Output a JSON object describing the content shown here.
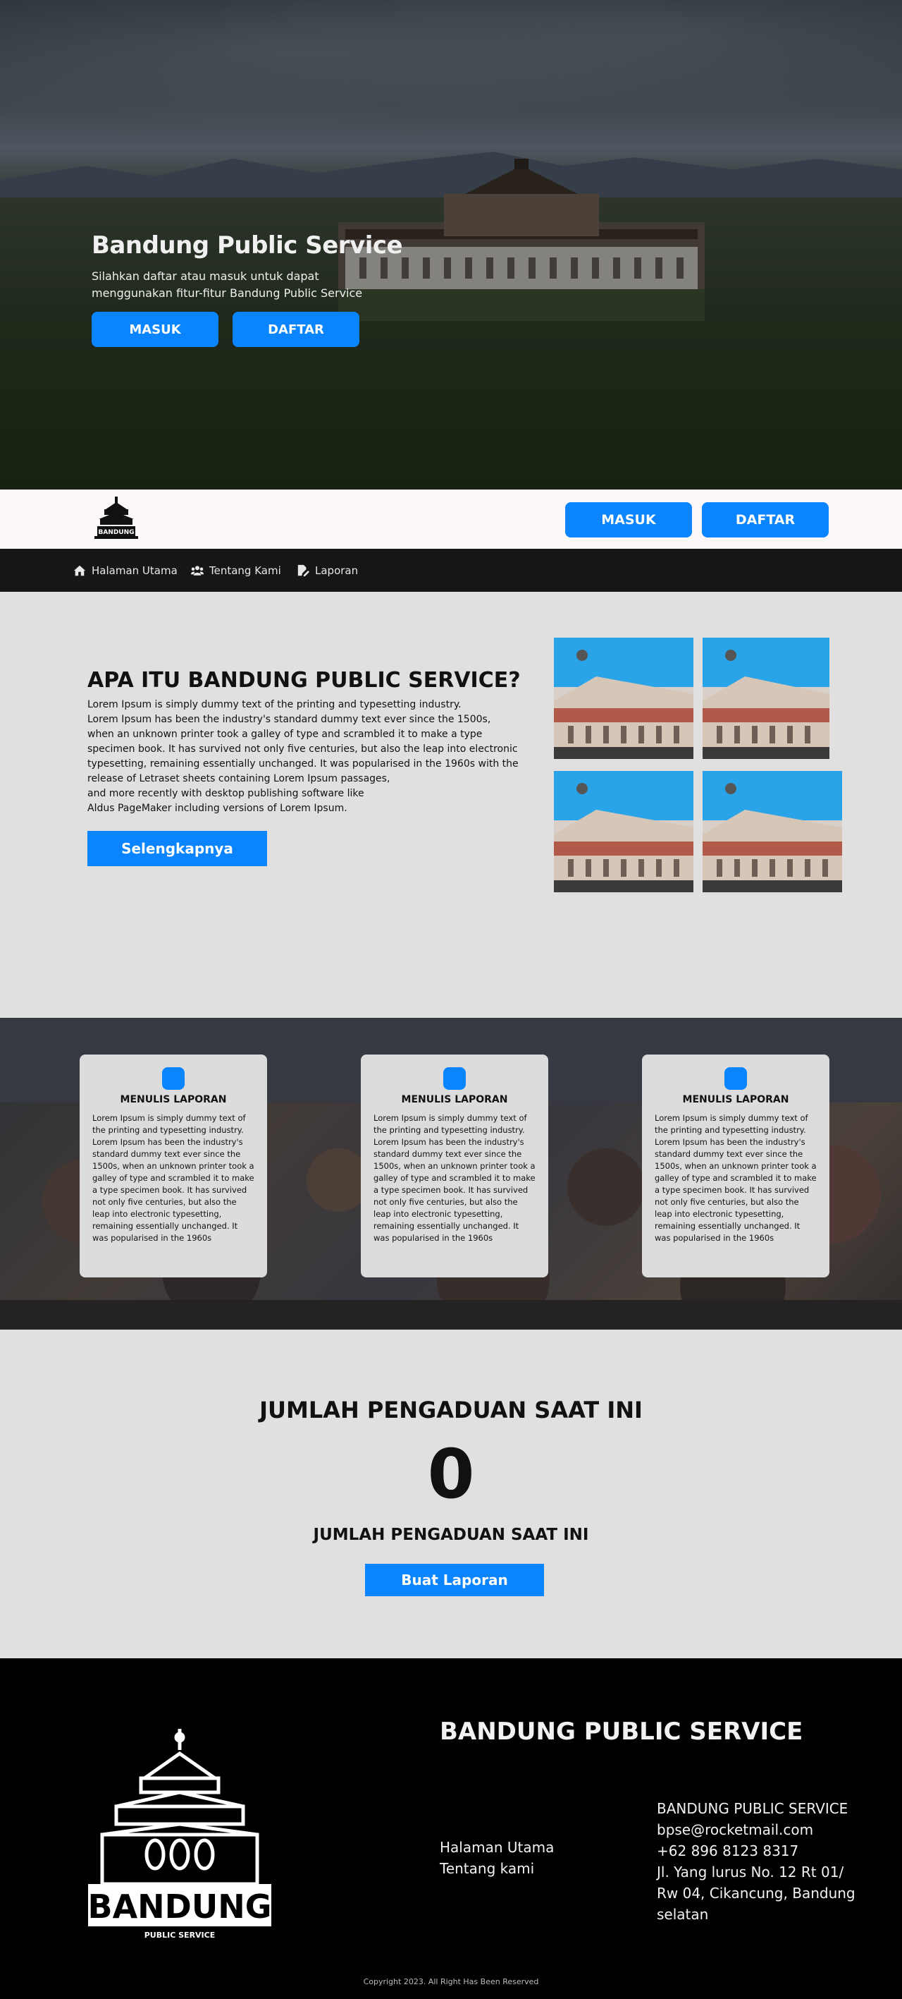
{
  "hero": {
    "title": "Bandung Public Service",
    "subtitle": "Silahkan daftar atau masuk untuk dapat menggunakan fitur-fitur Bandung Public Service",
    "login_label": "MASUK",
    "register_label": "DAFTAR"
  },
  "header": {
    "logo": "bandung-logo",
    "login_label": "MASUK",
    "register_label": "DAFTAR"
  },
  "nav": {
    "items": [
      {
        "label": "Halaman Utama",
        "icon": "home-icon"
      },
      {
        "label": "Tentang Kami",
        "icon": "users-icon"
      },
      {
        "label": "Laporan",
        "icon": "report-icon"
      }
    ]
  },
  "about": {
    "title": "APA ITU BANDUNG PUBLIC SERVICE?",
    "text": "Lorem Ipsum is simply dummy text of the printing and typesetting industry.\nLorem Ipsum has been the industry's standard dummy text ever since the 1500s,\nwhen an unknown printer took a galley of type and scrambled it to make a type\n specimen book. It has survived not only five centuries, but also the leap into electronic\ntypesetting, remaining essentially unchanged. It was popularised in the 1960s with the\n release of Letraset sheets containing Lorem Ipsum passages,\nand more recently with desktop publishing software like\nAldus PageMaker including versions of Lorem Ipsum.",
    "button_label": "Selengkapnya"
  },
  "features": {
    "cards": [
      {
        "title": "MENULIS LAPORAN",
        "text": "Lorem Ipsum is simply dummy text of the printing and typesetting industry. Lorem Ipsum has been the industry's standard dummy text ever since the 1500s, when an unknown printer took a galley of type and scrambled it to make a type specimen book. It has survived not only five centuries, but also the leap into electronic typesetting, remaining essentially unchanged. It was popularised in the 1960s"
      },
      {
        "title": "MENULIS LAPORAN",
        "text": "Lorem Ipsum is simply dummy text of the printing and typesetting industry. Lorem Ipsum has been the industry's standard dummy text ever since the 1500s, when an unknown printer took a galley of type and scrambled it to make a type specimen book. It has survived not only five centuries, but also the leap into electronic typesetting, remaining essentially unchanged. It was popularised in the 1960s"
      },
      {
        "title": "MENULIS LAPORAN",
        "text": "Lorem Ipsum is simply dummy text of the printing and typesetting industry. Lorem Ipsum has been the industry's standard dummy text ever since the 1500s, when an unknown printer took a galley of type and scrambled it to make a type specimen book. It has survived not only five centuries, but also the leap into electronic typesetting, remaining essentially unchanged. It was popularised in the 1960s"
      }
    ]
  },
  "stats": {
    "heading": "JUMLAH PENGADUAN SAAT INI",
    "count": "0",
    "subheading": "JUMLAH PENGADUAN SAAT INI",
    "button_label": "Buat Laporan"
  },
  "footer": {
    "title": "BANDUNG PUBLIC SERVICE",
    "links": [
      "Halaman Utama",
      "Tentang kami"
    ],
    "contact": {
      "name": "BANDUNG PUBLIC SERVICE",
      "email": "bpse@rocketmail.com",
      "phone": "+62 896 8123 8317",
      "address": "Jl. Yang lurus No. 12 Rt 01/ Rw 04, Cikancung, Bandung selatan"
    },
    "copyright": "Copyright 2023. All Right Has Been Reserved",
    "logo_word": "BANDUNG",
    "logo_tag": "PUBLIC SERVICE"
  },
  "colors": {
    "accent": "#0a84ff",
    "nav_bg": "#161616",
    "page_bg": "#e0e0e0",
    "footer_bg": "#000000"
  }
}
